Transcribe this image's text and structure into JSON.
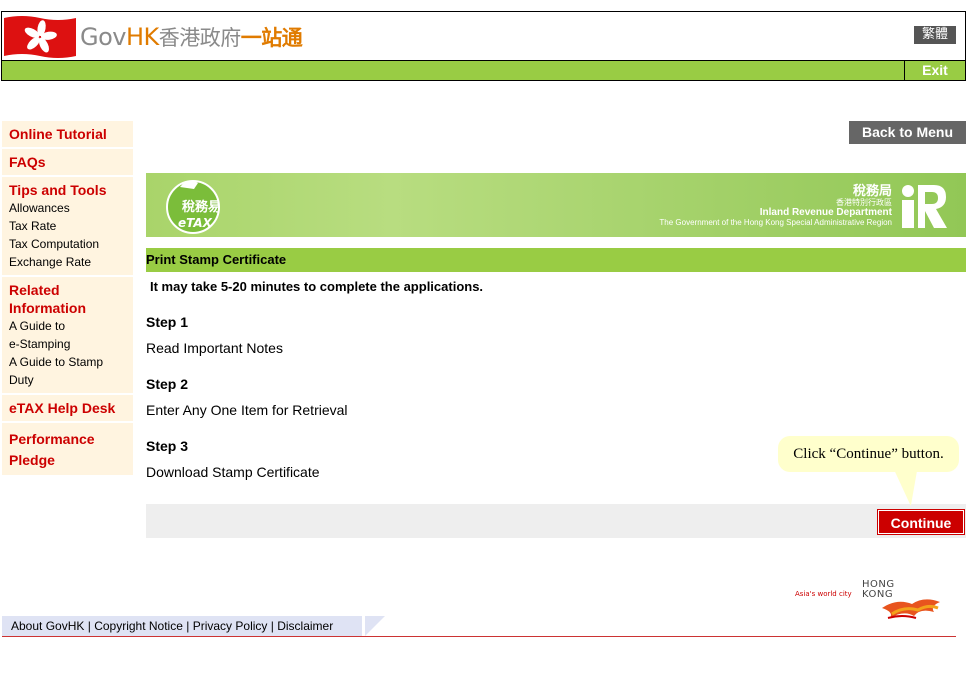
{
  "header": {
    "logo_gov": "Gov",
    "logo_hk": "HK",
    "logo_zh_a": "香港政府",
    "logo_zh_b": "一站通",
    "lang_toggle": "繁體",
    "exit_label": "Exit"
  },
  "sidebar": {
    "online_tutorial": "Online Tutorial",
    "faqs": "FAQs",
    "tips_title": "Tips and Tools",
    "tips_items": [
      "Allowances",
      "Tax Rate",
      "Tax Computation",
      "Exchange Rate"
    ],
    "related_title_1": "Related",
    "related_title_2": "Information",
    "related_items": [
      "A Guide to",
      "e-Stamping",
      "A Guide to Stamp",
      "Duty"
    ],
    "help_desk": "eTAX Help Desk",
    "pledge_1": "Performance",
    "pledge_2": "Pledge"
  },
  "main": {
    "back_to_menu": "Back to Menu",
    "banner": {
      "etax_zh": "稅務易",
      "etax_en": "eTAX",
      "ird_zh": "稅務局",
      "ird_zh_sub": "香港特別行政區",
      "ird_en": "Inland Revenue Department",
      "ird_gov": "The Government of the Hong Kong Special Administrative Region"
    },
    "section_title": "Print Stamp Certificate",
    "time_note": "It may take 5-20 minutes to complete the applications.",
    "steps": [
      {
        "head": "Step 1",
        "text": "Read Important Notes"
      },
      {
        "head": "Step 2",
        "text": "Enter Any One Item for Retrieval"
      },
      {
        "head": "Step 3",
        "text": "Download Stamp Certificate"
      }
    ],
    "callout": "Click “Continue” button.",
    "continue_label": "Continue"
  },
  "brand": {
    "tagline": "Asia's world city",
    "hk1": "HONG",
    "hk2": "KONG"
  },
  "footer": {
    "about": "About GovHK",
    "copyright": "Copyright Notice",
    "privacy": "Privacy Policy",
    "disclaimer": "Disclaimer",
    "sep": "|"
  },
  "colors": {
    "green": "#99cc44",
    "red": "#cc0000",
    "sidebar_bg": "#fff4e0",
    "callout_bg": "#ffffcc"
  }
}
